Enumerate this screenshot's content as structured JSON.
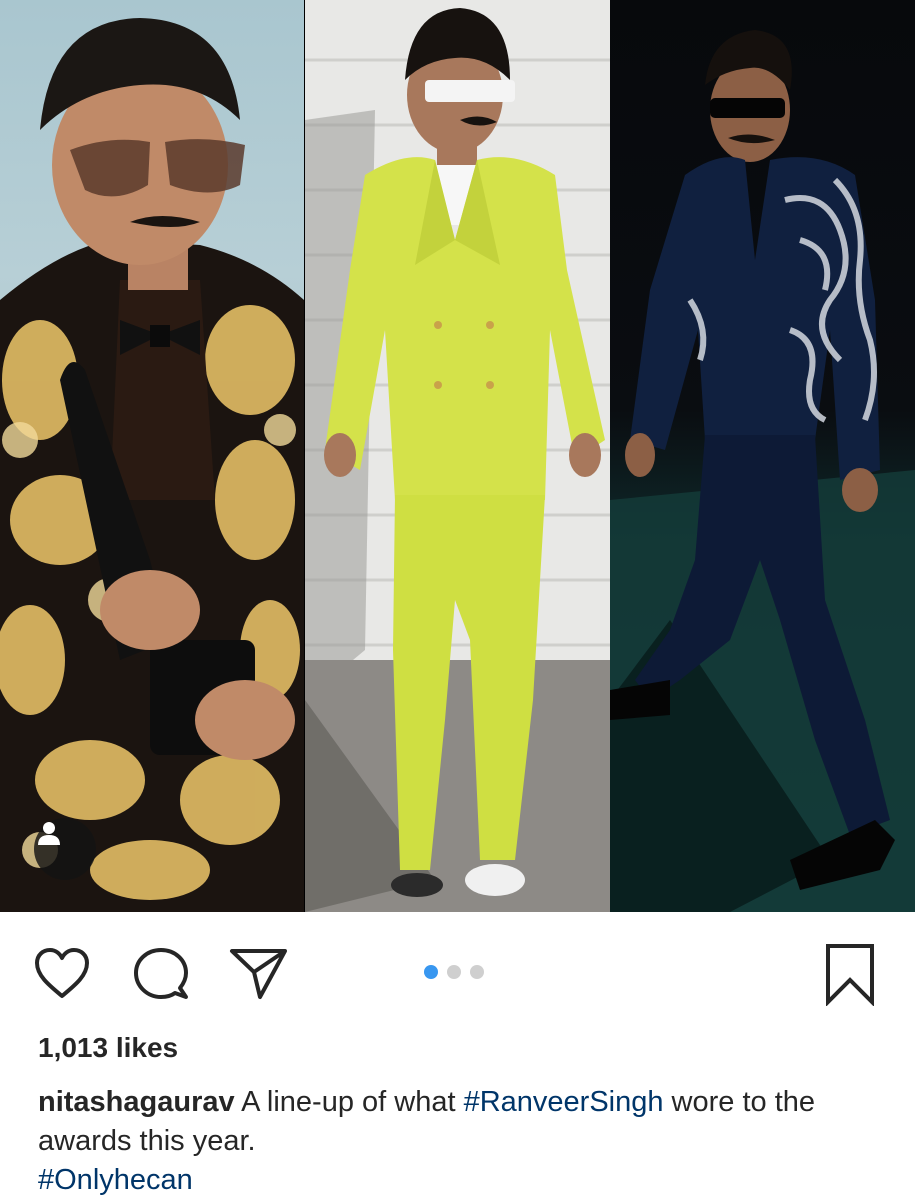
{
  "post": {
    "likes_label": "1,013 likes",
    "caption": {
      "username": "nitashagaurav",
      "text_before": " A line-up of what ",
      "hashtag_1": "#RanveerSingh",
      "text_after": " wore to the awards this year.",
      "hashtag_2": "#Onlyhecan"
    },
    "carousel": {
      "total": 3,
      "active": 1
    }
  },
  "icons": {
    "like": "heart-icon",
    "comment": "comment-bubble-icon",
    "share": "paper-plane-icon",
    "save": "bookmark-icon",
    "tag": "user-tag-icon"
  },
  "colors": {
    "hashtag": "#003569",
    "active_dot": "#3897f0",
    "inactive_dot": "#cfcfcf",
    "text": "#262626"
  }
}
